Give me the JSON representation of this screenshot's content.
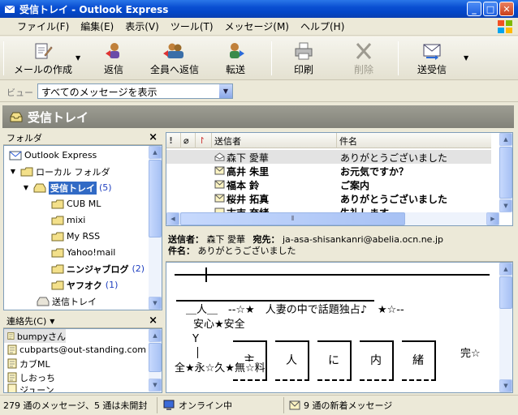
{
  "window": {
    "title": "受信トレイ - Outlook Express"
  },
  "menu": [
    "ファイル(F)",
    "編集(E)",
    "表示(V)",
    "ツール(T)",
    "メッセージ(M)",
    "ヘルプ(H)"
  ],
  "toolbar": {
    "create_mail": "メールの作成",
    "reply": "返信",
    "reply_all": "全員へ返信",
    "forward": "転送",
    "print": "印刷",
    "delete": "削除",
    "send_receive": "送受信"
  },
  "view": {
    "label": "ビュー",
    "value": "すべてのメッセージを表示"
  },
  "folder_title": "受信トレイ",
  "folders": {
    "header": "フォルダ",
    "items": [
      {
        "label": "Outlook Express",
        "count": ""
      },
      {
        "label": "ローカル フォルダ",
        "count": ""
      },
      {
        "label": "受信トレイ",
        "count": "(5)"
      },
      {
        "label": "CUB ML",
        "count": ""
      },
      {
        "label": "mixi",
        "count": ""
      },
      {
        "label": "My RSS",
        "count": ""
      },
      {
        "label": "Yahoo!mail",
        "count": ""
      },
      {
        "label": "ニンジャブログ",
        "count": "(2)"
      },
      {
        "label": "ヤフオク",
        "count": "(1)"
      },
      {
        "label": "送信トレイ",
        "count": ""
      }
    ]
  },
  "contacts": {
    "header": "連絡先(C)",
    "items": [
      "bumpyさん",
      "cubparts@out-standing.com",
      "カブML",
      "しおっち",
      "ジューン"
    ]
  },
  "message_list": {
    "columns": {
      "from": "送信者",
      "subject": "件名"
    },
    "rows": [
      {
        "from": "森下 愛華",
        "subject": "ありがとうございました",
        "read": true
      },
      {
        "from": "高井 朱里",
        "subject": "お元気ですか？",
        "read": false
      },
      {
        "from": "福本 鈴",
        "subject": "ご案内",
        "read": false
      },
      {
        "from": "桜井 拓真",
        "subject": "ありがとうございました",
        "read": false
      },
      {
        "from": "末吉 奈緒",
        "subject": "失礼します",
        "read": false
      }
    ]
  },
  "preview": {
    "from_label": "送信者：",
    "from_value": "森下 愛華",
    "to_label": "宛先：",
    "to_value": "ja-asa-shisankanri@abelia.ocn.ne.jp",
    "subject_label": "件名：",
    "subject_value": "ありがとうございました",
    "body": {
      "line1": "――|――――――――――――――――――――――――",
      "line2": "＿人＿　--☆★　人妻の中で話題独占♪　★☆--",
      "line3": "安心★安全",
      "line4": "Y",
      "boxes": [
        "主",
        "人",
        "に",
        "内",
        "緒"
      ],
      "tail1": "完☆",
      "line6": "全★永☆久★無☆料"
    }
  },
  "status": {
    "messages": "279 通のメッセージ、5 通は未開封",
    "online": "オンライン中",
    "new_mail": "9 通の新着メッセージ"
  },
  "colors": {
    "title_bar": "#0a4fd2",
    "selection": "#316ac5",
    "folder_bar": "#8f8f86"
  }
}
